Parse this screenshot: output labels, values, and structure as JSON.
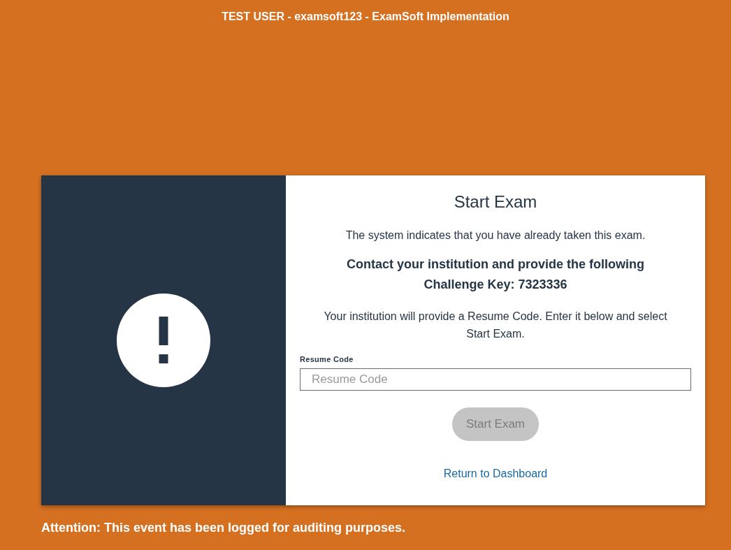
{
  "header": {
    "title": "TEST USER - examsoft123 - ExamSoft Implementation"
  },
  "card": {
    "title": "Start Exam",
    "message": "The system indicates that you have already taken this exam.",
    "instruction": "Contact your institution and provide the following Challenge Key: 7323336",
    "note": "Your institution will provide a Resume Code. Enter it below and select Start Exam.",
    "field": {
      "label": "Resume Code",
      "placeholder": "Resume Code"
    },
    "button": {
      "label": "Start Exam",
      "disabled": true
    },
    "link": "Return to Dashboard"
  },
  "footer": {
    "notice": "Attention: This event has been logged for auditing purposes."
  }
}
